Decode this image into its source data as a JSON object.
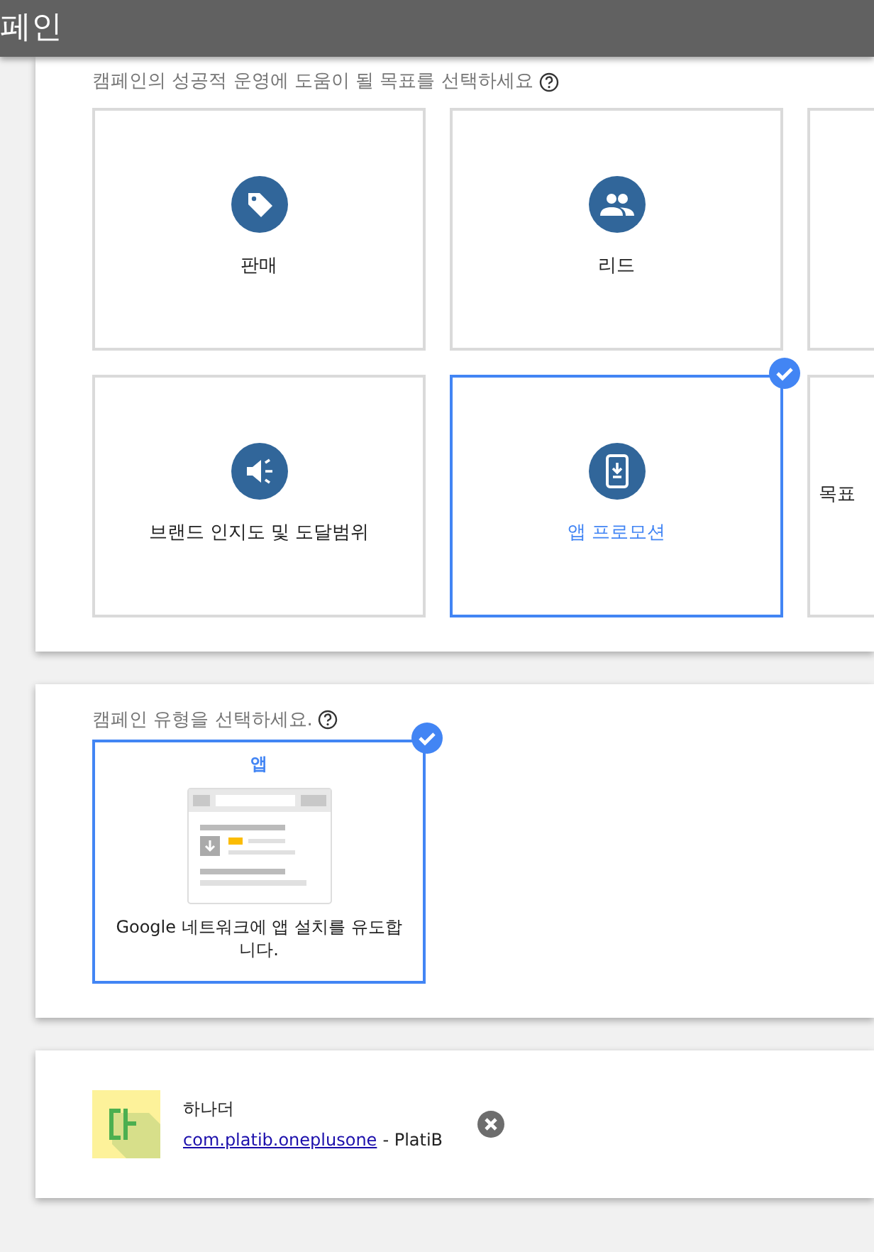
{
  "header": {
    "title": "페인"
  },
  "goals": {
    "prompt": "캠페인의 성공적 운영에 도움이 될 목표를 선택하세요",
    "tiles": [
      {
        "kind": "tag",
        "label": "판매",
        "selected": false
      },
      {
        "kind": "people",
        "label": "리드",
        "selected": false
      },
      {
        "kind": "blank",
        "selected": false
      },
      {
        "kind": "megaphone",
        "label": "브랜드 인지도 및 도달범위",
        "selected": false
      },
      {
        "kind": "phone",
        "label": "앱 프로모션",
        "selected": true
      },
      {
        "kind": "blank",
        "label": "목표",
        "selected": false
      }
    ]
  },
  "campaign_type": {
    "prompt": "캠페인 유형을 선택하세요.",
    "options": [
      {
        "title": "앱",
        "description": "Google 네트워크에 앱 설치를 유도합니다.",
        "selected": true
      }
    ]
  },
  "app": {
    "name": "하나더",
    "package": "com.platib.oneplusone",
    "suffix": "- PlatiB"
  }
}
